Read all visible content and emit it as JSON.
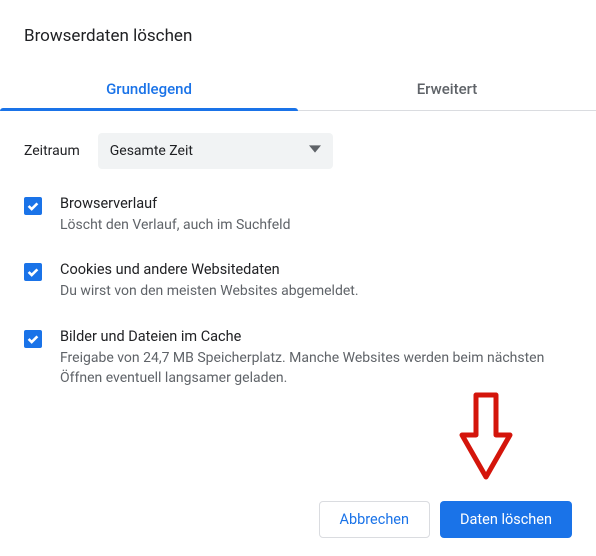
{
  "dialog": {
    "title": "Browserdaten löschen"
  },
  "tabs": {
    "basic": "Grundlegend",
    "advanced": "Erweitert"
  },
  "timerange": {
    "label": "Zeitraum",
    "selected": "Gesamte Zeit"
  },
  "options": [
    {
      "title": "Browserverlauf",
      "desc": "Löscht den Verlauf, auch im Suchfeld"
    },
    {
      "title": "Cookies und andere Websitedaten",
      "desc": "Du wirst von den meisten Websites abgemeldet."
    },
    {
      "title": "Bilder und Dateien im Cache",
      "desc": "Freigabe von 24,7 MB Speicherplatz. Manche Websites werden beim nächsten Öffnen eventuell langsamer geladen."
    }
  ],
  "buttons": {
    "cancel": "Abbrechen",
    "confirm": "Daten löschen"
  }
}
